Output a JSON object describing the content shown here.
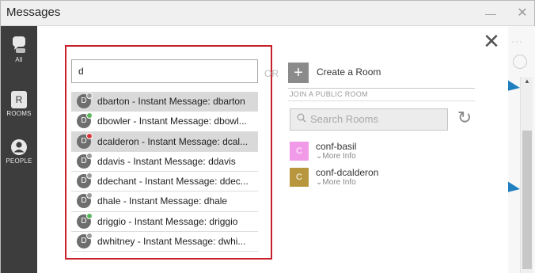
{
  "window": {
    "title": "Messages"
  },
  "rail": {
    "items": [
      {
        "label": "All",
        "icon": "chat-bubbles-icon"
      },
      {
        "label": "ROOMS",
        "icon": "rooms-icon",
        "glyph": "R"
      },
      {
        "label": "PEOPLE",
        "icon": "person-icon"
      }
    ]
  },
  "search": {
    "value": "d",
    "or_label": "OR"
  },
  "results": [
    {
      "avatar": "D",
      "status": "offline",
      "text": "dbarton - Instant Message: dbarton",
      "selected": true
    },
    {
      "avatar": "D",
      "status": "available",
      "text": "dbowler - Instant Message: dbowl...",
      "selected": false
    },
    {
      "avatar": "D",
      "status": "busy",
      "text": "dcalderon - Instant Message: dcal...",
      "selected": true
    },
    {
      "avatar": "D",
      "status": "offline",
      "text": "ddavis - Instant Message: ddavis",
      "selected": false
    },
    {
      "avatar": "D",
      "status": "offline",
      "text": "ddechant - Instant Message: ddec...",
      "selected": false
    },
    {
      "avatar": "D",
      "status": "offline",
      "text": "dhale - Instant Message: dhale",
      "selected": false
    },
    {
      "avatar": "D",
      "status": "available",
      "text": "driggio - Instant Message: driggio",
      "selected": false
    },
    {
      "avatar": "D",
      "status": "offline",
      "text": "dwhitney - Instant Message: dwhi...",
      "selected": false
    }
  ],
  "status_colors": {
    "offline": "#9b9b9b",
    "available": "#5cb85c",
    "busy": "#d9363e"
  },
  "create_room": {
    "label": "Create a Room"
  },
  "join": {
    "heading": "JOIN A PUBLIC ROOM",
    "search_placeholder": "Search Rooms"
  },
  "rooms": [
    {
      "initial": "C",
      "name": "conf-basil",
      "more": "More Info",
      "color": "#f09ae8"
    },
    {
      "initial": "C",
      "name": "conf-dcalderon",
      "more": "More Info",
      "color": "#b8963e"
    }
  ],
  "colors": {
    "rail": "#3d3d3d",
    "highlight_frame": "#c8202a",
    "accent_blue": "#1f7fbf"
  }
}
